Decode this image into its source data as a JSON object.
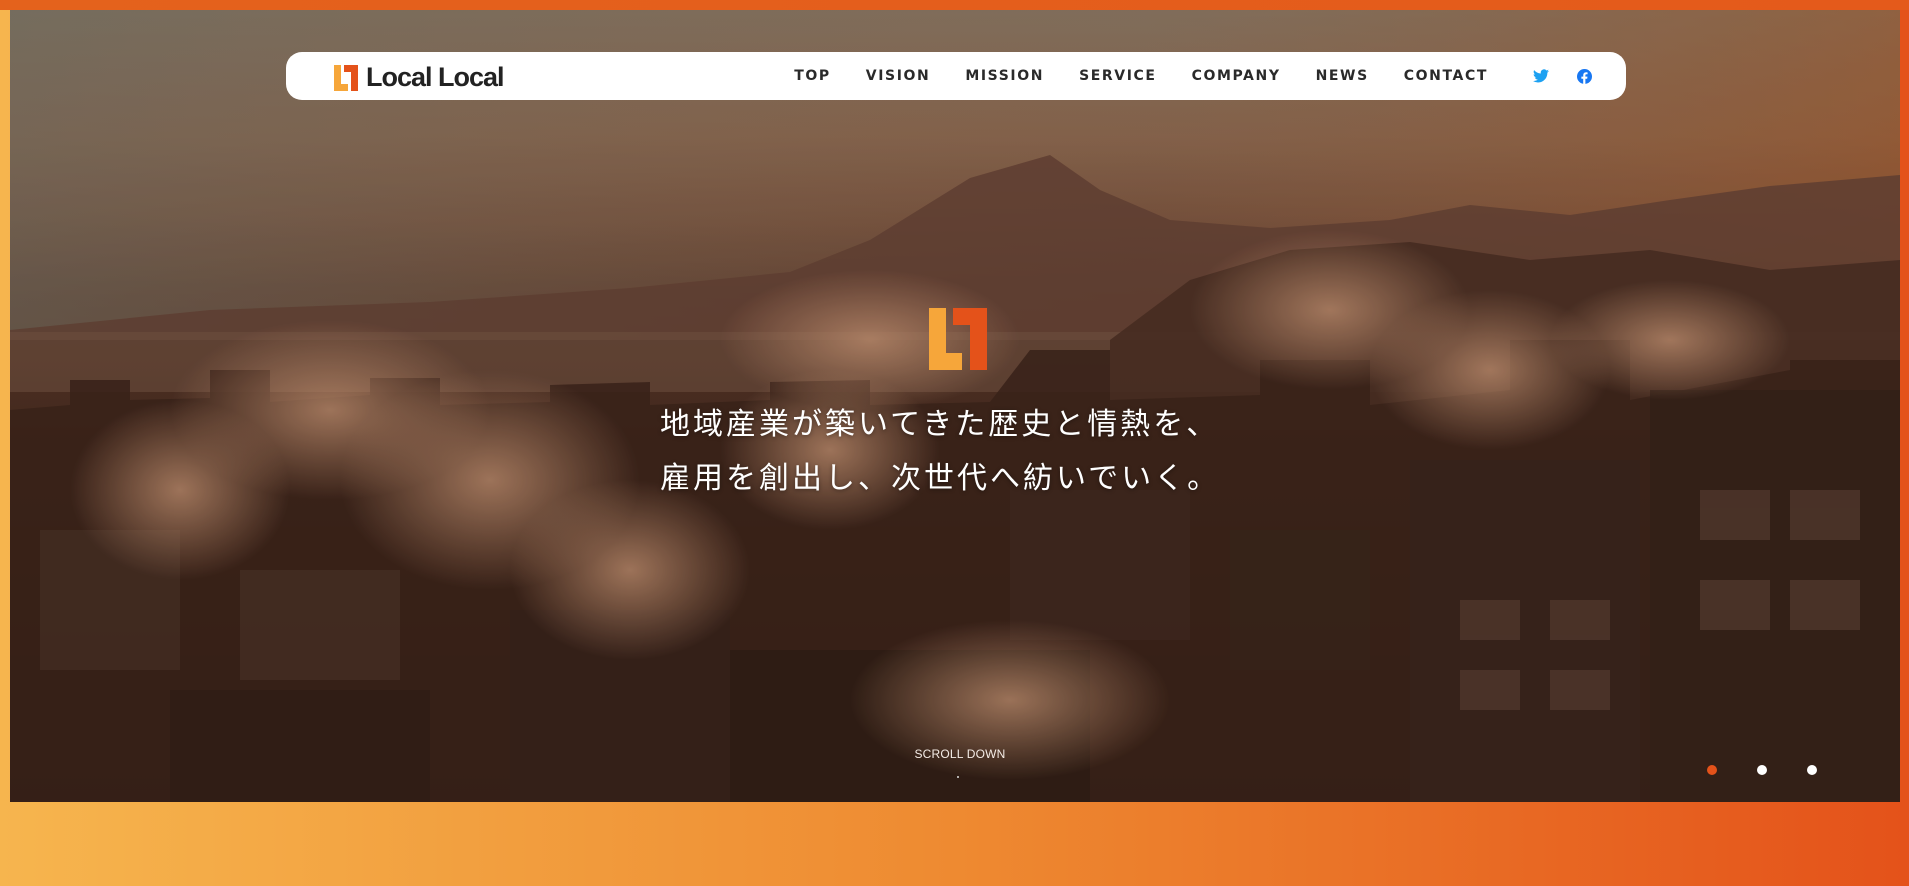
{
  "brand": {
    "name": "Local Local",
    "logo_icon": "local-local-logo-icon",
    "colors": {
      "orange": "#e4521a",
      "yellow": "#f6b54e"
    }
  },
  "nav": {
    "items": [
      {
        "label": "TOP"
      },
      {
        "label": "VISION"
      },
      {
        "label": "MISSION"
      },
      {
        "label": "SERVICE"
      },
      {
        "label": "COMPANY"
      },
      {
        "label": "NEWS"
      },
      {
        "label": "CONTACT"
      }
    ],
    "social": [
      {
        "icon": "twitter-icon",
        "color": "#1da1f2"
      },
      {
        "icon": "facebook-icon",
        "color": "#1877f2"
      }
    ]
  },
  "hero": {
    "headline_line1": "地域産業が築いてきた歴史と情熱を、",
    "headline_line2": "雇用を創出し、次世代へ紡いでいく。",
    "scroll_label": "SCROLL DOWN",
    "slider": {
      "count": 3,
      "active_index": 0
    }
  }
}
